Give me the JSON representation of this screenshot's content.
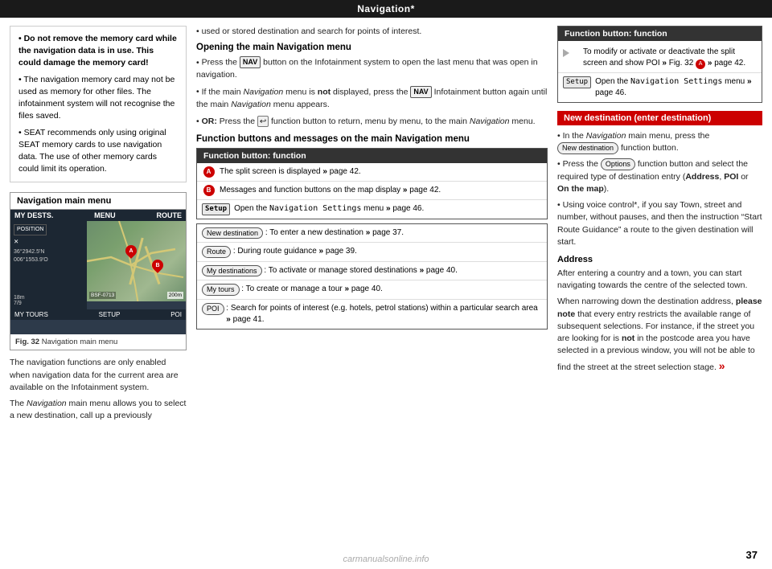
{
  "page": {
    "top_bar_title": "Navigation*",
    "page_number": "37"
  },
  "left": {
    "warning_bullets": [
      "Do not remove the memory card while the navigation data is in use. This could damage the memory card!",
      "The navigation memory card may not be used as memory for other files. The infotainment system will not recognise the files saved.",
      "SEAT recommends only using original SEAT memory cards to use navigation data. The use of other memory cards could limit its operation."
    ],
    "nav_menu_title": "Navigation main menu",
    "nav_top_items": [
      "MY DESTS.",
      "MENU",
      "ROUTE"
    ],
    "nav_bottom_items": [
      "MY TOURS",
      "SETUP",
      "POI"
    ],
    "nav_coords_line1": "36°2942.5'N",
    "nav_coords_line2": "006°1553.9'O",
    "nav_distance": "18m",
    "nav_time": "7/9",
    "nav_ref": "BSF-0713",
    "fig_label": "Fig. 32",
    "fig_caption": "Navigation main menu",
    "body_text_1": "The navigation functions are only enabled when navigation data for the current area are available on the Infotainment system.",
    "body_text_2": "The Navigation main menu allows you to select a new destination, call up a previously"
  },
  "middle": {
    "continuation_text": "used or stored destination and search for points of interest.",
    "heading_opening": "Opening the main Navigation menu",
    "bullet1": "Press the",
    "bullet1_key": "NAV",
    "bullet1_rest": "button on the Infotainment system to open the last menu that was open in navigation.",
    "bullet2_start": "If the main",
    "bullet2_nav": "Navigation",
    "bullet2_rest": "menu is",
    "bullet2_not": "not",
    "bullet2_end": "displayed, press the",
    "bullet2_key": "NAV",
    "bullet2_end2": "Infotainment button again until the main",
    "bullet2_nav2": "Navigation",
    "bullet2_end3": "menu appears.",
    "bullet3_or": "OR:",
    "bullet3_rest": "Press the",
    "bullet3_func": "function button to return, menu by menu, to the main",
    "bullet3_nav": "Navigation",
    "bullet3_end": "menu.",
    "heading_func": "Function buttons and messages on the main Navigation menu",
    "func_table_header": "Function button: function",
    "func_rows": [
      {
        "icon_type": "circle",
        "icon_label": "A",
        "text": "The split screen is displayed » page 42."
      },
      {
        "icon_type": "circle",
        "icon_label": "B",
        "text": "Messages and function buttons on the map display » page 42."
      }
    ],
    "setup_row_badge": "Setup",
    "setup_row_text": "Open the Navigation Settings menu » page 46.",
    "new_dest_btn_text": "New destination",
    "new_dest_row_text": "To enter a new destination » page 37.",
    "route_btn_text": "Route",
    "route_row_text": "During route guidance » page 39.",
    "my_dests_btn_text": "My destinations",
    "my_dests_row_text": "To activate or manage stored destinations » page 40.",
    "my_tours_btn_text": "My tours",
    "my_tours_row_text": "To create or manage a tour » page 40.",
    "poi_btn_text": "POI",
    "poi_row_text": "Search for points of interest (e.g. hotels, petrol stations) within a particular search area » page 41."
  },
  "right": {
    "new_dest_header": "New destination (enter destination)",
    "func_table_header": "Function button: function",
    "func_row_1_text": "To modify or activate or deactivate the split screen and show POI » Fig. 32",
    "func_row_1_badge": "A",
    "func_row_1_end": "» page 42.",
    "func_row_2_badge": "Setup",
    "func_row_2_text": "Open the",
    "func_row_2_key": "Navigation Settings",
    "func_row_2_end": "menu » page 46.",
    "bullet1_start": "In the",
    "bullet1_nav": "Navigation",
    "bullet1_rest": "main menu, press the",
    "bullet1_btn": "New destination",
    "bullet1_end": "function button.",
    "bullet2_start": "Press the",
    "bullet2_btn": "Options",
    "bullet2_rest": "function button and select the required type of destination entry (",
    "bullet2_addr": "Address",
    "bullet2_poi": "POI",
    "bullet2_or": "or",
    "bullet2_map": "On the map",
    "bullet2_end": ").",
    "bullet3_text": "Using voice control*, if you say Town, street and number, without pauses, and then the instruction “Start Route Guidance” a route to the given destination will start.",
    "addr_heading": "Address",
    "addr_text1": "After entering a country and a town, you can start navigating towards the centre of the selected town.",
    "addr_text2_start": "When narrowing down the destination address,",
    "addr_text2_bold": "please note",
    "addr_text2_rest": "that every entry restricts the available range of subsequent selections. For instance, if the street you are looking for is",
    "addr_text2_not": "not",
    "addr_text2_end": "in the postcode area you have selected in a previous window, you will not be able to find the street at the street selection stage.",
    "continue_symbol": "»"
  }
}
